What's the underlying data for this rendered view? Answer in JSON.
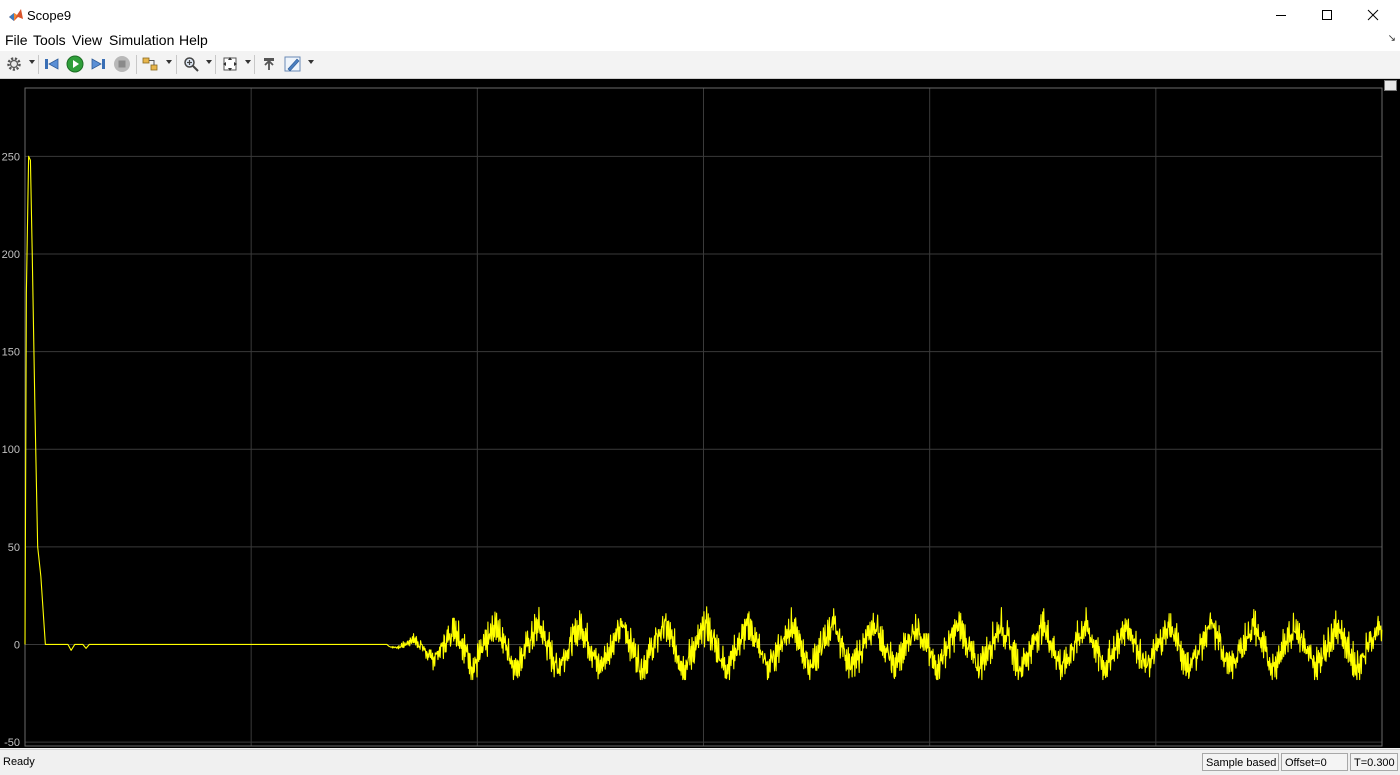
{
  "window": {
    "title": "Scope9",
    "minimize_label": "—",
    "maximize_label": "☐",
    "close_label": "✕"
  },
  "menu": {
    "file": "File",
    "tools": "Tools",
    "view": "View",
    "simulation": "Simulation",
    "help": "Help"
  },
  "toolbar": {
    "icons": [
      "gear-icon",
      "step-back-icon",
      "run-icon",
      "step-forward-icon",
      "stop-icon",
      "highlight-block-icon",
      "zoom-icon",
      "autoscale-icon",
      "restore-view-icon",
      "style-icon"
    ]
  },
  "status": {
    "text": "Ready",
    "sample_mode": "Sample based",
    "offset": "Offset=0",
    "time": "T=0.300"
  },
  "colors": {
    "signal": "#ffff00",
    "background": "#000000",
    "grid": "#3a3a3a",
    "axis_text": "#c0c0c0"
  },
  "chart_data": {
    "type": "line",
    "title": "",
    "xlabel": "",
    "ylabel": "",
    "xlim": [
      0,
      0.3
    ],
    "ylim": [
      -52,
      285
    ],
    "xticks": [
      "0",
      "0.05",
      "0.1",
      "0.15",
      "0.2",
      "0.25",
      "0.3"
    ],
    "yticks": [
      "-50",
      "0",
      "50",
      "100",
      "150",
      "200",
      "250"
    ],
    "grid": true,
    "series": [
      {
        "color": "#ffff00",
        "description_points": [
          [
            0,
            0
          ],
          [
            0.0003,
            180
          ],
          [
            0.0008,
            250
          ],
          [
            0.0012,
            248
          ],
          [
            0.0016,
            200
          ],
          [
            0.0022,
            120
          ],
          [
            0.0028,
            50
          ],
          [
            0.0035,
            35
          ],
          [
            0.0045,
            0
          ],
          [
            0.0095,
            0
          ],
          [
            0.0102,
            -3
          ],
          [
            0.011,
            0
          ],
          [
            0.0128,
            0
          ],
          [
            0.0135,
            -2
          ],
          [
            0.0142,
            0
          ],
          [
            0.08,
            0
          ],
          [
            0.3,
            0
          ]
        ],
        "oscillation": {
          "start_x": 0.0805,
          "period_x": 0.0093,
          "amplitude_max": 15,
          "offset": -1,
          "peak_max": 23,
          "trough_min": -18
        }
      }
    ]
  }
}
